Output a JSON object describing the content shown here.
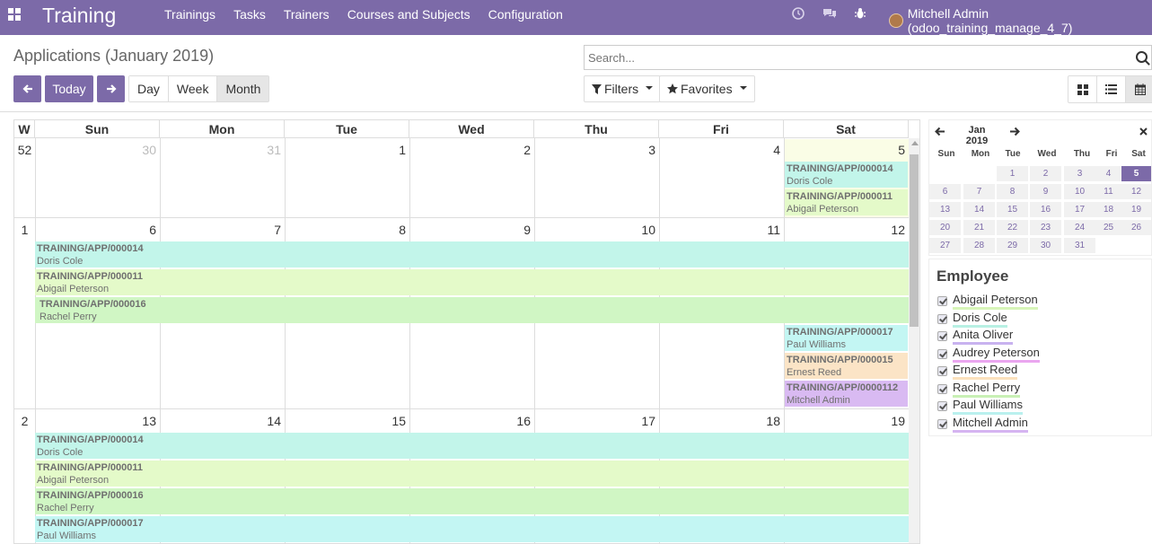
{
  "app": {
    "title": "Training"
  },
  "menu": [
    "Trainings",
    "Tasks",
    "Trainers",
    "Courses and Subjects",
    "Configuration"
  ],
  "user": {
    "name": "Mitchell Admin (odoo_training_manage_4_7)"
  },
  "page_title": "Applications (January 2019)",
  "search": {
    "placeholder": "Search..."
  },
  "nav": {
    "today": "Today",
    "modes": [
      "Day",
      "Week",
      "Month"
    ],
    "active_mode": "Month"
  },
  "filters_label": "Filters",
  "favorites_label": "Favorites",
  "calendar": {
    "week_header": "W",
    "days": [
      "Sun",
      "Mon",
      "Tue",
      "Wed",
      "Thu",
      "Fri",
      "Sat"
    ],
    "weeks": [
      {
        "num": "52",
        "dates": [
          "30",
          "31",
          "1",
          "2",
          "3",
          "4",
          "5"
        ]
      },
      {
        "num": "1",
        "dates": [
          "6",
          "7",
          "8",
          "9",
          "10",
          "11",
          "12"
        ]
      },
      {
        "num": "2",
        "dates": [
          "13",
          "14",
          "15",
          "16",
          "17",
          "18",
          "19"
        ]
      }
    ],
    "events": [
      {
        "ref": "TRAINING/APP/000014",
        "name": "Doris Cole",
        "color": "#c2f5ea"
      },
      {
        "ref": "TRAINING/APP/000011",
        "name": "Abigail Peterson",
        "color": "#e4fac9"
      },
      {
        "ref": "TRAINING/APP/000016",
        "name": "Rachel Perry",
        "color": "#d0f6c4"
      },
      {
        "ref": "TRAINING/APP/000017",
        "name": "Paul Williams",
        "color": "#c3f6f3"
      },
      {
        "ref": "TRAINING/APP/000015",
        "name": "Ernest Reed",
        "color": "#fbe4c6"
      },
      {
        "ref": "TRAINING/APP/0000112",
        "name": "Mitchell Admin",
        "color": "#d9baf2"
      }
    ]
  },
  "mini_calendar": {
    "title": "Jan 2019",
    "days": [
      "Sun",
      "Mon",
      "Tue",
      "Wed",
      "Thu",
      "Fri",
      "Sat"
    ],
    "rows": [
      [
        "",
        "",
        "1",
        "2",
        "3",
        "4",
        "5"
      ],
      [
        "6",
        "7",
        "8",
        "9",
        "10",
        "11",
        "12"
      ],
      [
        "13",
        "14",
        "15",
        "16",
        "17",
        "18",
        "19"
      ],
      [
        "20",
        "21",
        "22",
        "23",
        "24",
        "25",
        "26"
      ],
      [
        "27",
        "28",
        "29",
        "30",
        "31",
        "",
        ""
      ]
    ],
    "selected": "5"
  },
  "employee_filter": {
    "title": "Employee",
    "items": [
      {
        "name": "Abigail Peterson",
        "color": "#d7f5b9"
      },
      {
        "name": "Doris Cole",
        "color": "#b8f0e3"
      },
      {
        "name": "Anita Oliver",
        "color": "#c8b2ef"
      },
      {
        "name": "Audrey Peterson",
        "color": "#eaa6ef"
      },
      {
        "name": "Ernest Reed",
        "color": "#fbe1bd"
      },
      {
        "name": "Rachel Perry",
        "color": "#c8f0b5"
      },
      {
        "name": "Paul Williams",
        "color": "#b9f0ee"
      },
      {
        "name": "Mitchell Admin",
        "color": "#d5b4f1"
      }
    ]
  }
}
